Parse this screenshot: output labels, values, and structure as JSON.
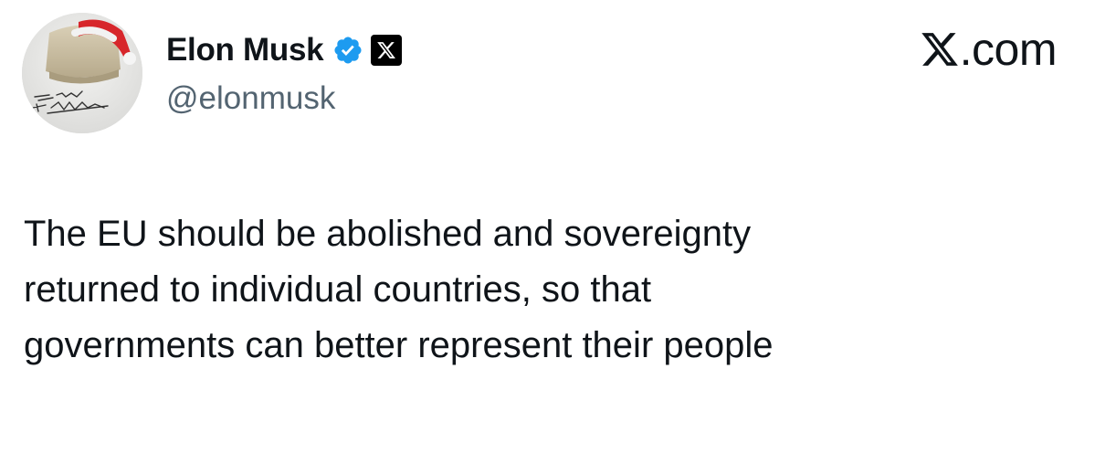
{
  "author": {
    "display_name": "Elon Musk",
    "handle": "@elonmusk",
    "avatar": {
      "description_icon": "avatar-icon",
      "signature_text": "The Nihilist Wheel"
    },
    "verified_icon": "verified-checkmark-icon",
    "affiliation_icon": "x-logo-icon"
  },
  "site": {
    "label": ".com",
    "logo_icon": "x-logo-icon"
  },
  "tweet": {
    "lines": [
      "The EU should be abolished and sovereignty",
      "returned to individual countries, so that",
      "governments can better represent their people"
    ]
  },
  "colors": {
    "text": "#0f1419",
    "muted": "#536471",
    "verified_blue": "#1d9bf0",
    "background": "#ffffff"
  }
}
